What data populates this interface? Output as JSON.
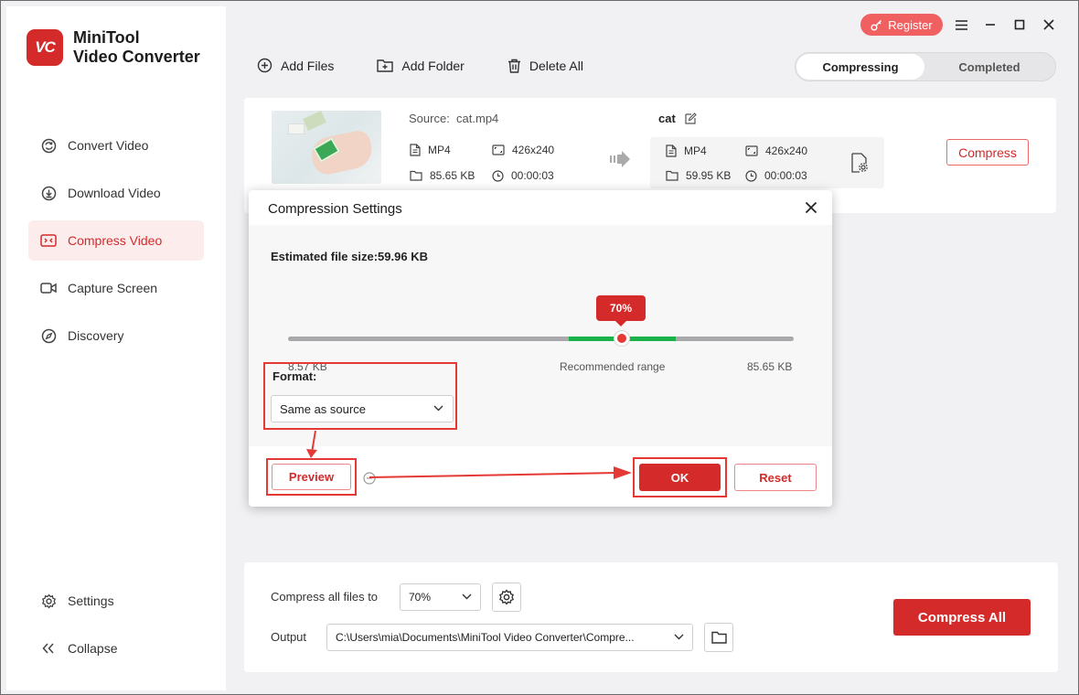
{
  "app": {
    "name_line1": "MiniTool",
    "name_line2": "Video Converter",
    "logo_letters": "VC",
    "accent_color": "#d42a2a"
  },
  "sidebar": {
    "items": [
      {
        "label": "Convert Video",
        "icon": "convert-icon"
      },
      {
        "label": "Download Video",
        "icon": "download-icon"
      },
      {
        "label": "Compress Video",
        "icon": "compress-icon",
        "active": true
      },
      {
        "label": "Capture Screen",
        "icon": "camera-icon"
      },
      {
        "label": "Discovery",
        "icon": "compass-icon"
      }
    ],
    "bottom": [
      {
        "label": "Settings",
        "icon": "gear-icon"
      },
      {
        "label": "Collapse",
        "icon": "double-chevron-left-icon"
      }
    ]
  },
  "titlebar": {
    "register_label": "Register"
  },
  "toolbar": {
    "add_files": "Add Files",
    "add_folder": "Add Folder",
    "delete_all": "Delete All"
  },
  "tabs": {
    "compressing": "Compressing",
    "completed": "Completed"
  },
  "file": {
    "source_label": "Source:",
    "source_name": "cat.mp4",
    "src_format": "MP4",
    "src_resolution": "426x240",
    "src_size": "85.65 KB",
    "src_duration": "00:00:03",
    "out_name": "cat",
    "out_format": "MP4",
    "out_resolution": "426x240",
    "out_size": "59.95 KB",
    "out_duration": "00:00:03",
    "compress_label": "Compress"
  },
  "dialog": {
    "title": "Compression Settings",
    "estimated_label": "Estimated file size:",
    "estimated_value": "59.96 KB",
    "slider_percent": "70%",
    "slider_min": "8.57 KB",
    "slider_max": "85.65 KB",
    "recommended_label": "Recommended range",
    "format_label": "Format:",
    "format_value": "Same as source",
    "preview_label": "Preview",
    "ok_label": "OK",
    "reset_label": "Reset"
  },
  "bottom": {
    "compress_to_label": "Compress all files to",
    "compress_to_value": "70%",
    "output_label": "Output",
    "output_path": "C:\\Users\\mia\\Documents\\MiniTool Video Converter\\Compre...",
    "compress_all_label": "Compress All"
  }
}
